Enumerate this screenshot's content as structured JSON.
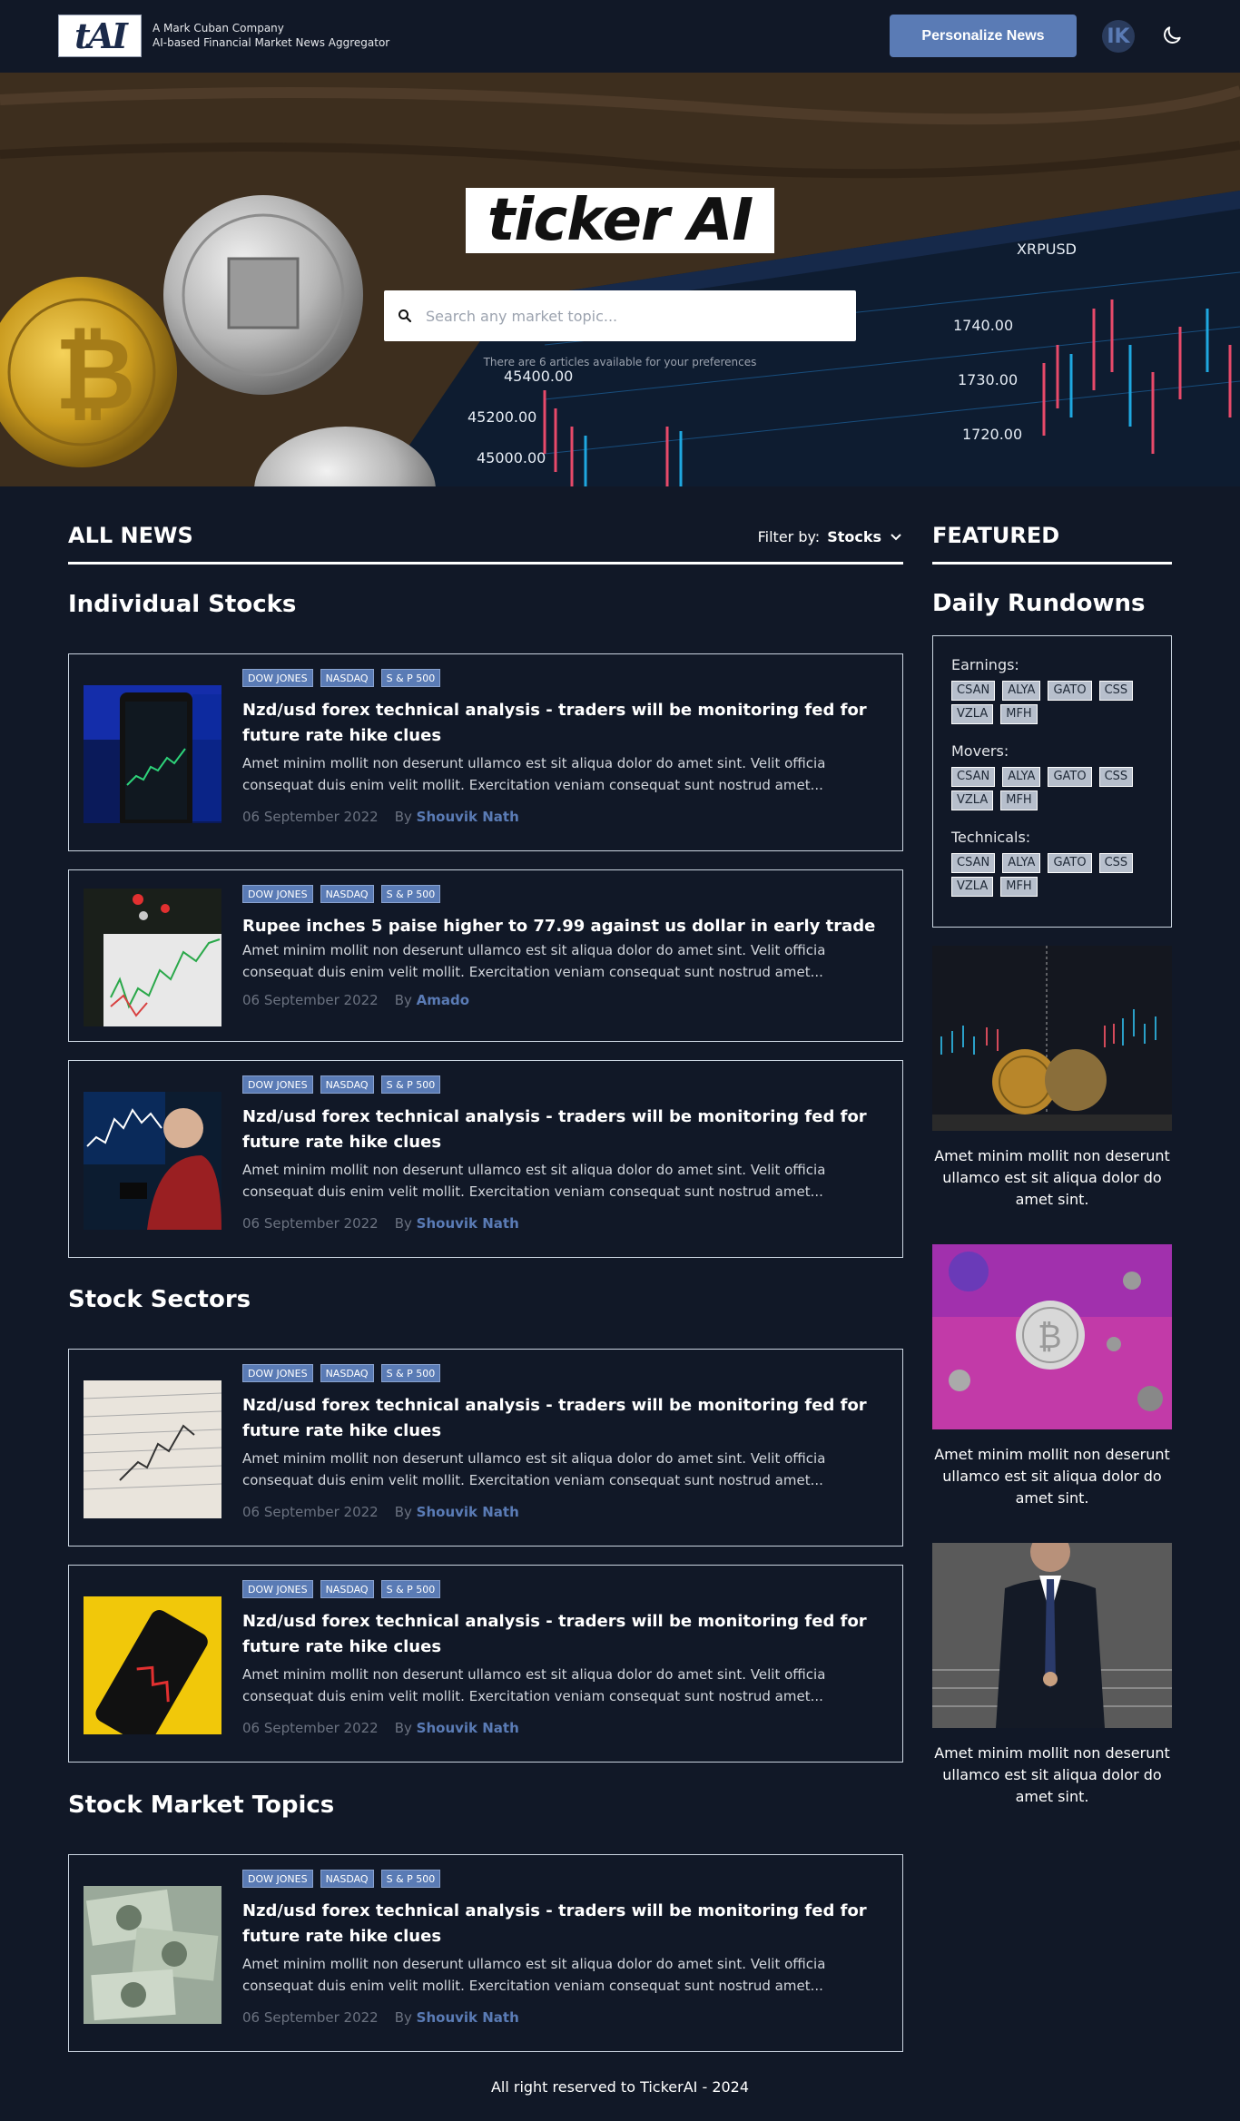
{
  "header": {
    "logo_text": "tAI",
    "tagline_line1": "A Mark Cuban Company",
    "tagline_line2": "AI-based Financial Market News Aggregator",
    "personalize_button": "Personalize News",
    "avatar_initials": "IK"
  },
  "hero": {
    "title": "ticker AI",
    "search_placeholder": "Search any market topic...",
    "note": "There are 6 articles available for your preferences"
  },
  "all_news": {
    "heading": "ALL NEWS",
    "filter_label": "Filter by:",
    "filter_value": "Stocks"
  },
  "featured": {
    "heading": "FEATURED",
    "daily_rundowns_title": "Daily Rundowns",
    "rundowns": [
      {
        "label": "Earnings:",
        "tickers": [
          "CSAN",
          "ALYA",
          "GATO",
          "CSS",
          "VZLA",
          "MFH"
        ]
      },
      {
        "label": "Movers:",
        "tickers": [
          "CSAN",
          "ALYA",
          "GATO",
          "CSS",
          "VZLA",
          "MFH"
        ]
      },
      {
        "label": "Technicals:",
        "tickers": [
          "CSAN",
          "ALYA",
          "GATO",
          "CSS",
          "VZLA",
          "MFH"
        ]
      }
    ],
    "items": [
      {
        "caption": "Amet minim mollit non deserunt ullamco est sit aliqua dolor do amet sint."
      },
      {
        "caption": "Amet minim mollit non deserunt ullamco est sit aliqua dolor do amet sint."
      },
      {
        "caption": "Amet minim mollit non deserunt ullamco est sit aliqua dolor do amet sint."
      }
    ]
  },
  "sections": [
    {
      "title": "Individual Stocks",
      "articles": [
        {
          "tags": [
            "DOW JONES",
            "NASDAQ",
            "S & P 500"
          ],
          "title": "Nzd/usd forex technical analysis - traders will be monitoring fed for future rate hike clues",
          "description": "Amet minim mollit non deserunt ullamco est sit aliqua dolor do amet sint. Velit officia consequat duis enim velit mollit. Exercitation veniam consequat sunt nostrud amet...",
          "date": "06 September 2022",
          "by": "By",
          "author": "Shouvik Nath"
        },
        {
          "tags": [
            "DOW JONES",
            "NASDAQ",
            "S & P 500"
          ],
          "title": "Rupee inches 5 paise higher to 77.99 against us dollar in early trade",
          "description": "Amet minim mollit non deserunt ullamco est sit aliqua dolor do amet sint. Velit officia consequat duis enim velit mollit. Exercitation veniam consequat sunt nostrud amet...",
          "date": "06 September 2022",
          "by": "By",
          "author": "Amado"
        },
        {
          "tags": [
            "DOW JONES",
            "NASDAQ",
            "S & P 500"
          ],
          "title": "Nzd/usd forex technical analysis - traders will be monitoring fed for future rate hike clues",
          "description": "Amet minim mollit non deserunt ullamco est sit aliqua dolor do amet sint. Velit officia consequat duis enim velit mollit. Exercitation veniam consequat sunt nostrud amet...",
          "date": "06 September 2022",
          "by": "By",
          "author": "Shouvik Nath"
        }
      ]
    },
    {
      "title": "Stock Sectors",
      "articles": [
        {
          "tags": [
            "DOW JONES",
            "NASDAQ",
            "S & P 500"
          ],
          "title": "Nzd/usd forex technical analysis - traders will be monitoring fed for future rate hike clues",
          "description": "Amet minim mollit non deserunt ullamco est sit aliqua dolor do amet sint. Velit officia consequat duis enim velit mollit. Exercitation veniam consequat sunt nostrud amet...",
          "date": "06 September 2022",
          "by": "By",
          "author": "Shouvik Nath"
        },
        {
          "tags": [
            "DOW JONES",
            "NASDAQ",
            "S & P 500"
          ],
          "title": "Nzd/usd forex technical analysis - traders will be monitoring fed for future rate hike clues",
          "description": "Amet minim mollit non deserunt ullamco est sit aliqua dolor do amet sint. Velit officia consequat duis enim velit mollit. Exercitation veniam consequat sunt nostrud amet...",
          "date": "06 September 2022",
          "by": "By",
          "author": "Shouvik Nath"
        }
      ]
    },
    {
      "title": "Stock Market Topics",
      "articles": [
        {
          "tags": [
            "DOW JONES",
            "NASDAQ",
            "S & P 500"
          ],
          "title": "Nzd/usd forex technical analysis - traders will be monitoring fed for future rate hike clues",
          "description": "Amet minim mollit non deserunt ullamco est sit aliqua dolor do amet sint. Velit officia consequat duis enim velit mollit. Exercitation veniam consequat sunt nostrud amet...",
          "date": "06 September 2022",
          "by": "By",
          "author": "Shouvik Nath"
        }
      ]
    }
  ],
  "footer": {
    "text": "All right reserved to TickerAI - 2024"
  },
  "colors": {
    "background": "#111827",
    "accent": "#5a7bb5",
    "card_border": "#cbd5e1",
    "muted_text": "#6b7280"
  }
}
